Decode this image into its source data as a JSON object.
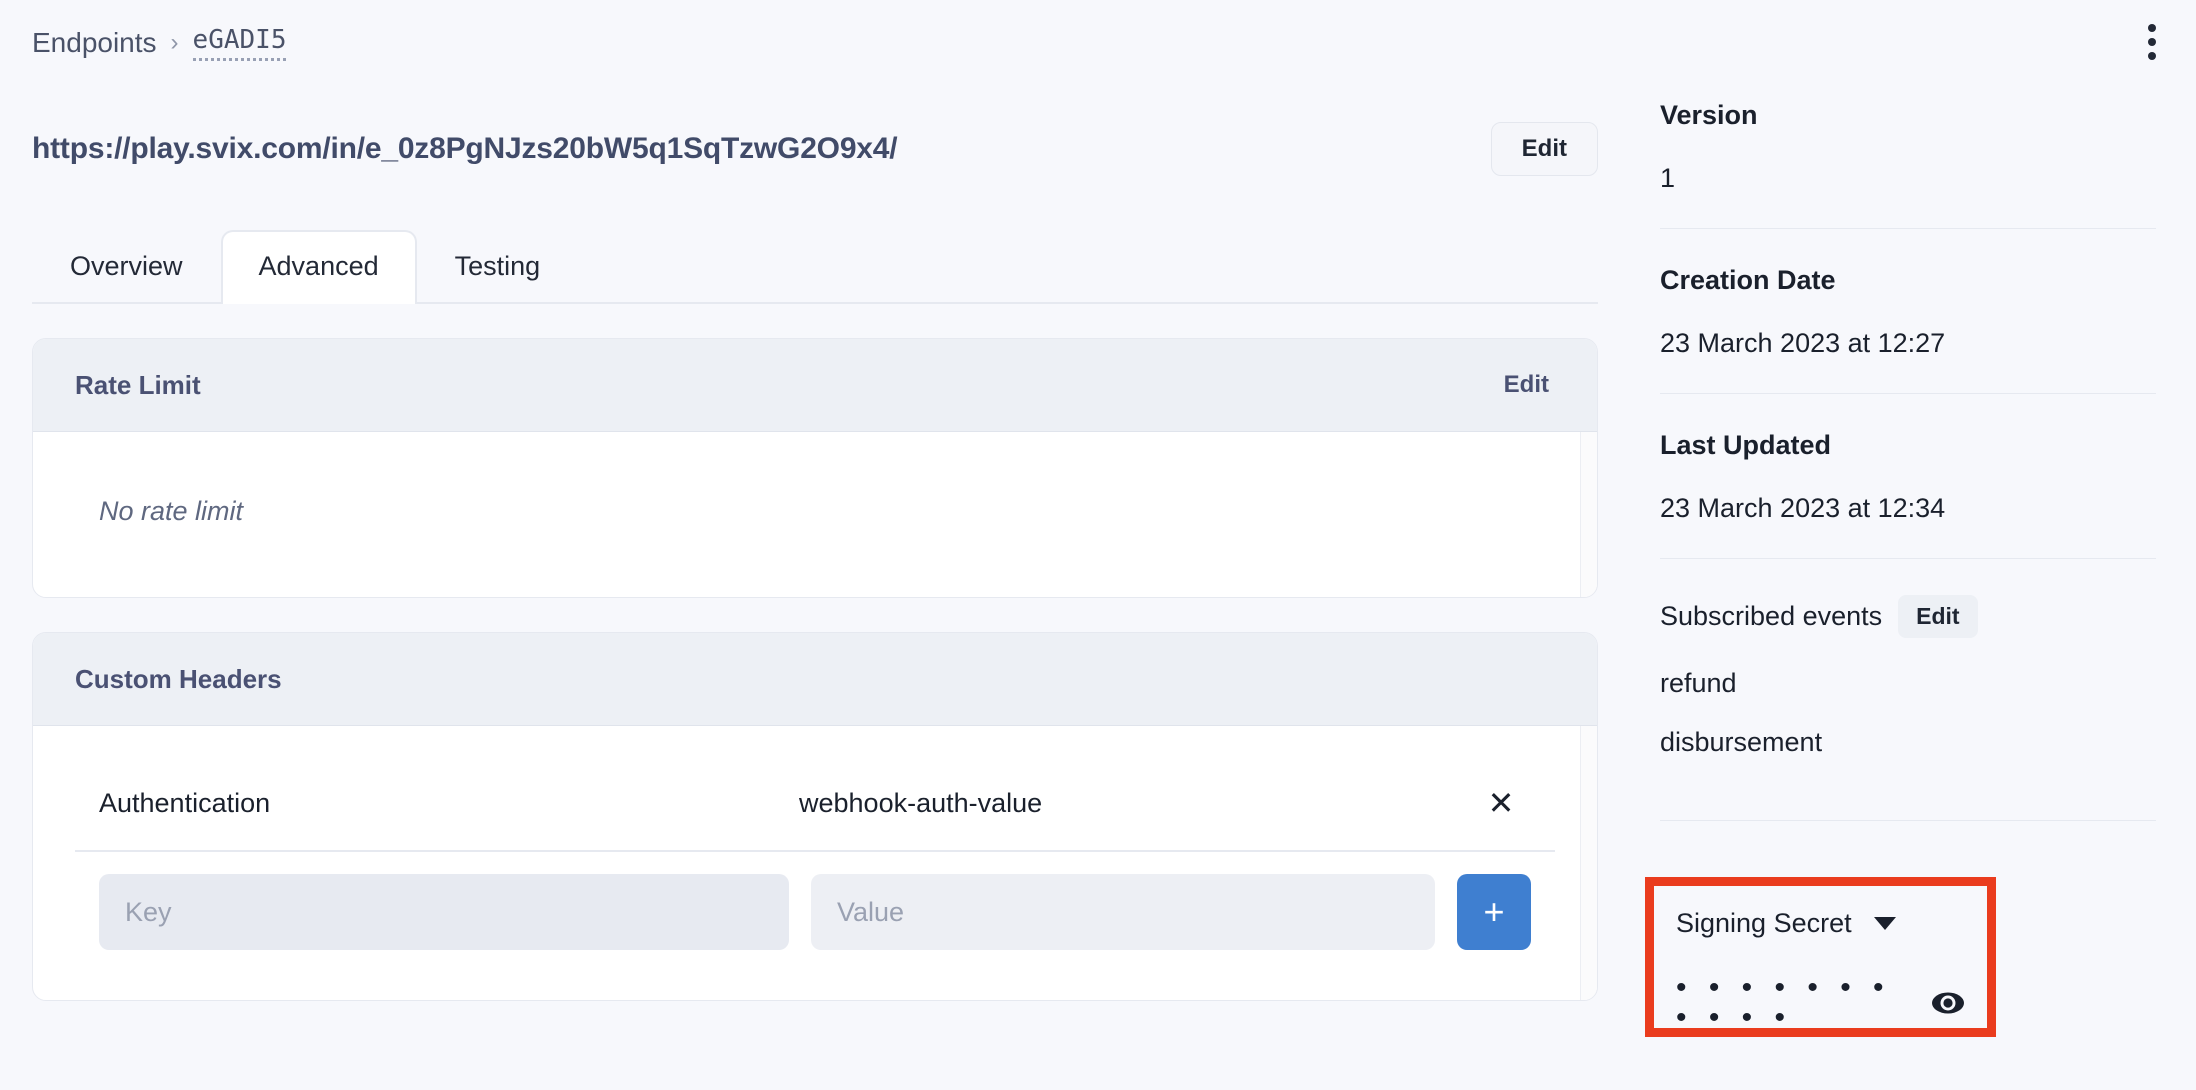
{
  "header": {
    "breadcrumb_root": "Endpoints",
    "breadcrumb_separator": "›",
    "breadcrumb_current": "eGADI5",
    "menu_icon": "kebab-menu-icon"
  },
  "endpoint": {
    "url": "https://play.svix.com/in/e_0z8PgNJzs20bW5q1SqTzwG2O9x4/",
    "edit_label": "Edit"
  },
  "tabs": [
    {
      "label": "Overview",
      "active": false
    },
    {
      "label": "Advanced",
      "active": true
    },
    {
      "label": "Testing",
      "active": false
    }
  ],
  "rate_limit": {
    "title": "Rate Limit",
    "edit_label": "Edit",
    "empty_text": "No rate limit"
  },
  "custom_headers": {
    "title": "Custom Headers",
    "rows": [
      {
        "key": "Authentication",
        "value": "webhook-auth-value",
        "remove_label": "✕"
      }
    ],
    "key_placeholder": "Key",
    "value_placeholder": "Value",
    "key_value": "",
    "value_value": "",
    "add_label": "+"
  },
  "sidebar": {
    "version": {
      "label": "Version",
      "value": "1"
    },
    "creation_date": {
      "label": "Creation Date",
      "value": "23 March 2023 at 12:27"
    },
    "last_updated": {
      "label": "Last Updated",
      "value": "23 March 2023 at 12:34"
    },
    "subscribed_events": {
      "label": "Subscribed events",
      "edit_label": "Edit",
      "items": [
        "refund",
        "disbursement"
      ]
    },
    "signing_secret": {
      "label": "Signing Secret",
      "masked_value": "• • • • • • • • • • •",
      "toggle_icon": "eye-icon",
      "expand_icon": "chevron-down-icon",
      "highlight_color": "#ea3c1e"
    }
  },
  "colors": {
    "page_background": "#f7f8fc",
    "card_header": "#edf0f5",
    "accent_blue": "#3f7fd0",
    "heading_slate": "#4a5173",
    "highlight_red": "#ea3c1e"
  }
}
